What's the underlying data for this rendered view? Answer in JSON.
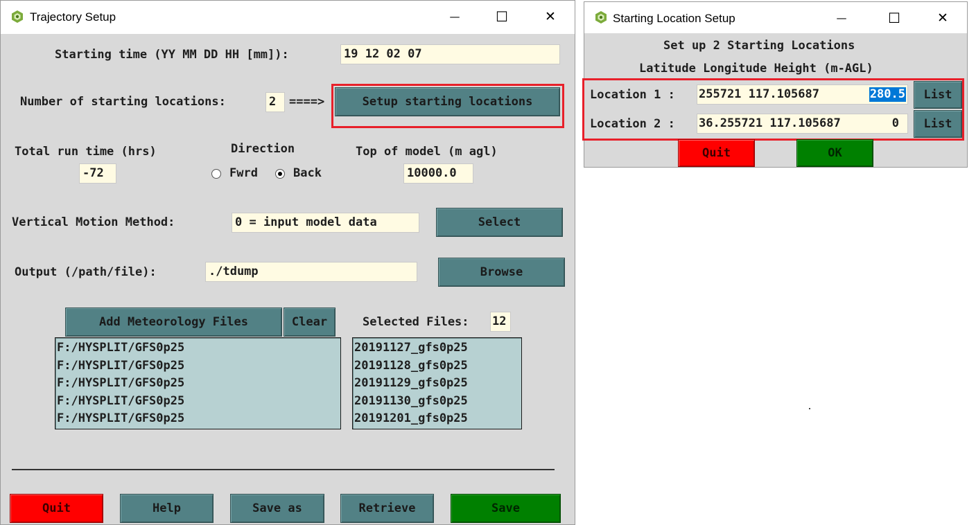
{
  "traj": {
    "title": "Trajectory Setup",
    "start_time_label": "Starting time (YY MM DD HH [mm]):",
    "start_time_value": "19 12 02 07",
    "num_loc_label": "Number of starting locations:",
    "num_loc_value": "2",
    "arrow": "====>",
    "setup_btn": "Setup starting locations",
    "run_time_label": "Total run time (hrs)",
    "run_time_value": "-72",
    "direction_label": "Direction",
    "fwrd_label": "Fwrd",
    "back_label": "Back",
    "direction_selected": "Back",
    "top_model_label": "Top of model (m agl)",
    "top_model_value": "10000.0",
    "vmm_label": "Vertical Motion Method:",
    "vmm_value": "0 = input model data",
    "select_btn": "Select",
    "output_label": "Output (/path/file):",
    "output_value": "./tdump",
    "browse_btn": "Browse",
    "add_met_btn": "Add Meteorology Files",
    "clear_btn": "Clear",
    "selected_files_label": "Selected Files:",
    "selected_files_count": "12",
    "met_dirs": [
      "F:/HYSPLIT/GFS0p25",
      "F:/HYSPLIT/GFS0p25",
      "F:/HYSPLIT/GFS0p25",
      "F:/HYSPLIT/GFS0p25",
      "F:/HYSPLIT/GFS0p25"
    ],
    "met_files": [
      "20191127_gfs0p25",
      "20191128_gfs0p25",
      "20191129_gfs0p25",
      "20191130_gfs0p25",
      "20191201_gfs0p25"
    ],
    "buttons": {
      "quit": "Quit",
      "help": "Help",
      "save_as": "Save as",
      "retrieve": "Retrieve",
      "save": "Save"
    }
  },
  "loc": {
    "title": "Starting Location Setup",
    "heading1": "Set up 2 Starting Locations",
    "heading2": "Latitude Longitude Height (m-AGL)",
    "locations": [
      {
        "label": "Location 1 :",
        "coords": "255721 117.105687",
        "height": "280.5",
        "list": "List"
      },
      {
        "label": "Location 2 :",
        "coords": "36.255721 117.105687",
        "height": "0",
        "list": "List"
      }
    ],
    "quit": "Quit",
    "ok": "OK"
  },
  "window_controls": {
    "minimize": "—",
    "maximize": "☐",
    "close": "✕"
  },
  "colors": {
    "button": "#528185",
    "quit": "#ff0000",
    "save": "#008000",
    "field": "#fffbe3",
    "listbox": "#b7d1d2",
    "highlight": "#e8202a",
    "selection": "#0078d7"
  }
}
